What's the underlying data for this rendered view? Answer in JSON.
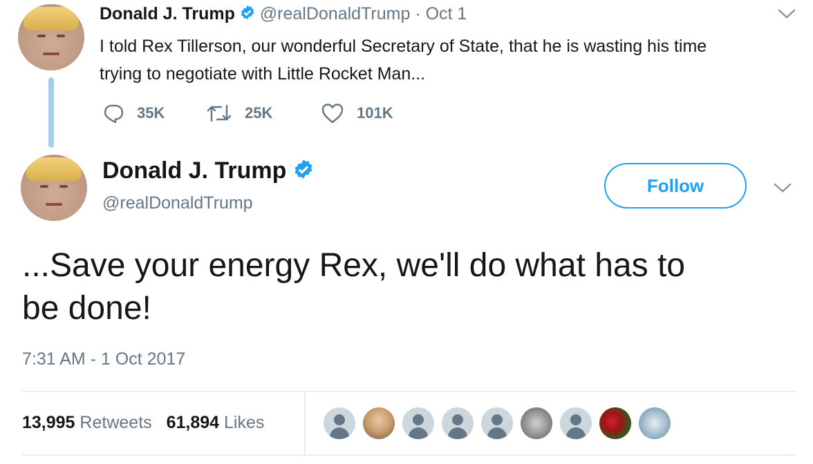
{
  "prev_tweet": {
    "name": "Donald J. Trump",
    "handle": "@realDonaldTrump",
    "sep": "·",
    "date": "Oct 1",
    "text_line1": "I told Rex Tillerson, our wonderful Secretary of State, that he is wasting his time",
    "text_line2": "trying to negotiate with Little Rocket Man...",
    "replies": "35K",
    "retweets": "25K",
    "likes": "101K"
  },
  "main_tweet": {
    "name": "Donald J. Trump",
    "handle": "@realDonaldTrump",
    "follow_label": "Follow",
    "text_line1": "...Save your energy Rex, we'll do what has to",
    "text_line2": "be done!",
    "timestamp": "7:31 AM - 1 Oct 2017",
    "retweet_count": "13,995",
    "retweet_label": "Retweets",
    "like_count": "61,894",
    "like_label": "Likes"
  },
  "colors": {
    "accent": "#1da1f2",
    "muted": "#657786",
    "thread_line": "#a2d0ea",
    "divider": "#e6ecf0"
  },
  "icons": [
    "verified-badge-icon",
    "chevron-down-icon",
    "reply-icon",
    "retweet-icon",
    "like-icon"
  ]
}
